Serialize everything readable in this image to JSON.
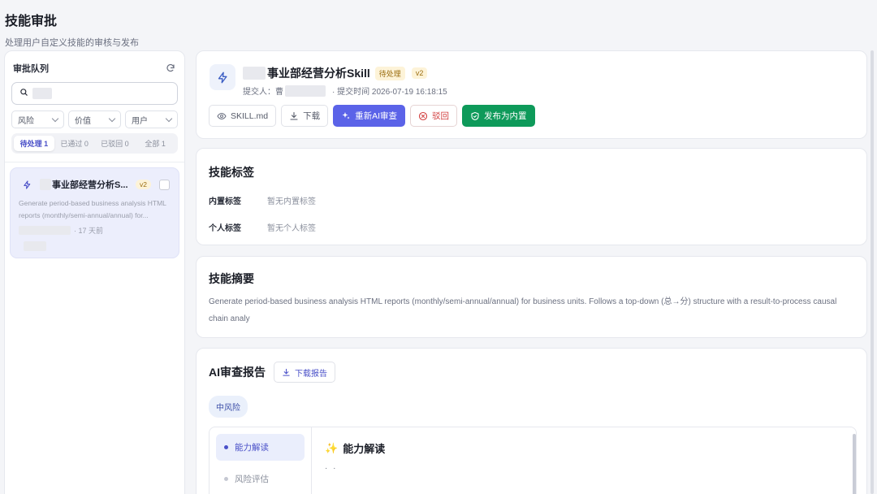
{
  "page": {
    "title": "技能审批",
    "subtitle": "处理用户自定义技能的审核与发布"
  },
  "queue": {
    "title": "审批队列",
    "search_placeholder": "",
    "filters": [
      "风险",
      "价值",
      "用户"
    ],
    "tabs": [
      "待处理 1",
      "已通过 0",
      "已驳回 0",
      "全部 1"
    ],
    "items": [
      {
        "name": "事业部经营分析S...",
        "version": "v2",
        "description": "Generate period-based business analysis HTML reports (monthly/semi-annual/annual) for...",
        "age": "· 17 天前"
      }
    ]
  },
  "detail": {
    "skill_name": "事业部经营分析Skill",
    "status": "待处理",
    "version": "v2",
    "submitter_label": "提交人：曹",
    "submit_time": "· 提交时间 2026-07-19 16:18:15",
    "actions": {
      "view_skill_md": "SKILL.md",
      "download": "下载",
      "rerun_ai_review": "重新AI审查",
      "reject": "驳回",
      "publish_builtin": "发布为内置"
    }
  },
  "tags": {
    "title": "技能标签",
    "builtin_label": "内置标签",
    "builtin_value": "暂无内置标签",
    "personal_label": "个人标签",
    "personal_value": "暂无个人标签"
  },
  "summary": {
    "title": "技能摘要",
    "text": "Generate period-based business analysis HTML reports (monthly/semi-annual/annual) for business units. Follows a top-down (总→分) structure with a result-to-process causal chain analy"
  },
  "ai_report": {
    "title": "AI审查报告",
    "download_label": "下载报告",
    "risk_level": "中风险",
    "nav": [
      "能力解读",
      "风险评估"
    ],
    "content_title": "能力解读",
    "content_emoji": "✨",
    "content_placeholder": "· ·"
  },
  "colors": {
    "primary": "#5b63e8",
    "success": "#0e9a5a",
    "danger": "#d23d3d",
    "pending_bg": "#fdf3d8"
  }
}
